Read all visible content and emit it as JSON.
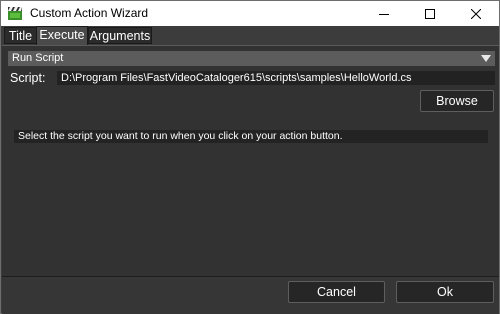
{
  "window": {
    "title": "Custom Action Wizard",
    "icon": "clapperboard-icon",
    "controls": [
      "minimize-icon",
      "maximize-icon",
      "close-icon"
    ]
  },
  "tabs": [
    {
      "label": "Title",
      "active": false
    },
    {
      "label": "Execute",
      "active": true
    },
    {
      "label": "Arguments",
      "active": false
    }
  ],
  "execute": {
    "action_type": "Run Script",
    "script_label": "Script:",
    "script_path": "D:\\Program Files\\FastVideoCataloger615\\scripts\\samples\\HelloWorld.cs",
    "browse_label": "Browse",
    "description": "Select the script you want to run when you click on your action button."
  },
  "footer": {
    "cancel_label": "Cancel",
    "ok_label": "Ok"
  },
  "colors": {
    "background": "#3c3c3c",
    "panel": "#323232",
    "dropdown": "#5c5c5c",
    "input": "#222222",
    "text": "#ffffff"
  }
}
